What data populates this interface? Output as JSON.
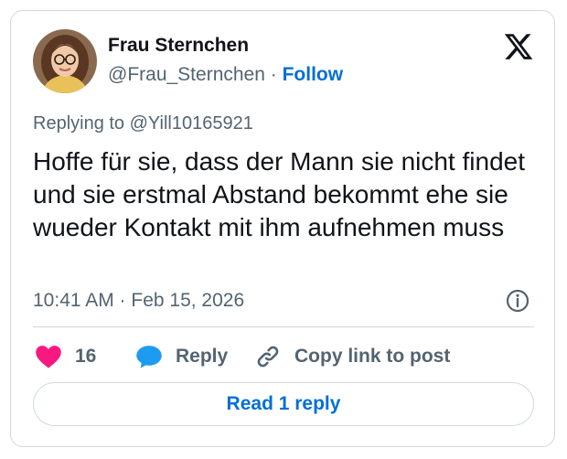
{
  "author": {
    "name": "Frau Sternchen",
    "handle": "@Frau_Sternchen",
    "separator": "·",
    "follow_label": "Follow"
  },
  "reply_context": "Replying to @Yill10165921",
  "tweet": {
    "text": "Hoffe für sie, dass der Mann sie nicht findet und sie erstmal Abstand bekommt ehe sie wueder Kontakt mit ihm aufnehmen muss",
    "timestamp": "10:41 AM · Feb 15, 2026"
  },
  "actions": {
    "like_count": "16",
    "reply_label": "Reply",
    "copy_link_label": "Copy link to post"
  },
  "read_replies_label": "Read 1 reply",
  "icons": {
    "brand": "x-logo-icon",
    "info": "info-icon",
    "like": "heart-icon",
    "reply": "speech-bubble-icon",
    "copy": "link-icon"
  },
  "colors": {
    "accent": "#006fd6",
    "like": "#f91880",
    "reply_icon": "#1d9bf0",
    "secondary_text": "#536471",
    "border": "#cfd9de"
  }
}
